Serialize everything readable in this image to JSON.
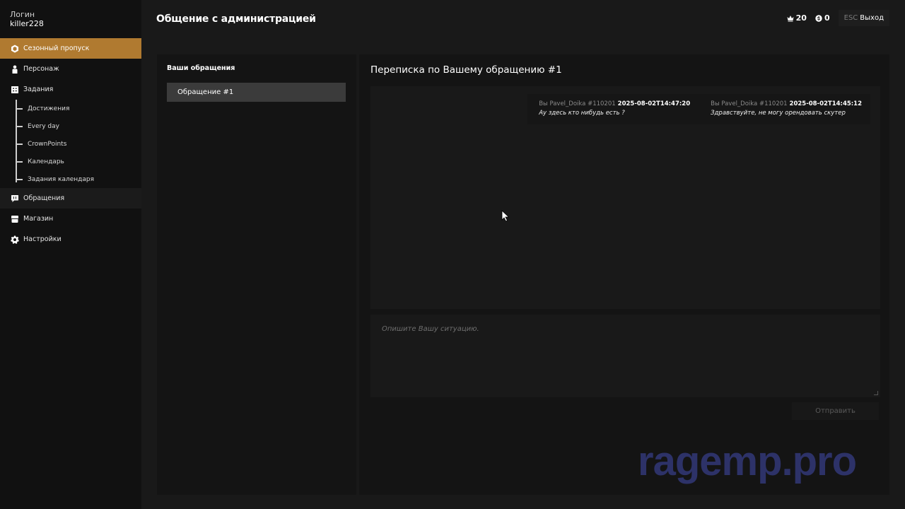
{
  "user": {
    "login_label": "Логин",
    "login_value": "killer228"
  },
  "sidebar": {
    "items": [
      {
        "label": "Сезонный пропуск",
        "icon": "season-pass-icon"
      },
      {
        "label": "Персонаж",
        "icon": "character-icon"
      },
      {
        "label": "Задания",
        "icon": "tasks-icon"
      }
    ],
    "sub_items": [
      {
        "label": "Достижения"
      },
      {
        "label": "Every day"
      },
      {
        "label": "CrownPoints"
      },
      {
        "label": "Календарь"
      },
      {
        "label": "Задания календаря"
      }
    ],
    "items2": [
      {
        "label": "Обращения",
        "icon": "chat-icon"
      },
      {
        "label": "Магазин",
        "icon": "shop-icon"
      },
      {
        "label": "Настройки",
        "icon": "gear-icon"
      }
    ]
  },
  "header": {
    "title": "Общение с администрацией",
    "crowns": "20",
    "coins": "0",
    "esc_key": "ESC",
    "exit_label": "Выход"
  },
  "tickets": {
    "heading": "Ваши обращения",
    "items": [
      {
        "label": "Обращение #1"
      }
    ]
  },
  "conversation": {
    "title": "Переписка по Вашему обращению #1",
    "messages": [
      {
        "author": "Вы Pavel_Doika #110201",
        "time": "2025-08-02T14:47:20",
        "text": "Ау здесь кто нибудь есть ?"
      },
      {
        "author": "Вы Pavel_Doika #110201",
        "time": "2025-08-02T14:45:12",
        "text": "Здравствуйте, не могу орендовать скутер"
      }
    ],
    "input_placeholder": "Опишите Вашу ситуацию.",
    "send_label": "Отправить"
  },
  "watermark": "ragemp.pro",
  "colors": {
    "accent": "#b07a30",
    "background": "#191919",
    "sidebar": "#111111",
    "watermark": "#2d3268"
  }
}
